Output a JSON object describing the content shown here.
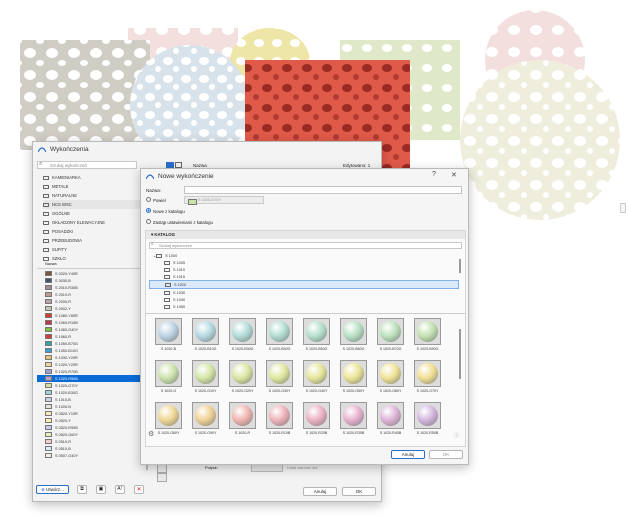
{
  "top_tab_label": "",
  "colors": {
    "accent": "#0a6bd6",
    "selected_row": "#0a6bd6",
    "dialog_bg": "#f3f3f3"
  },
  "main_window": {
    "title": "Wykończenia",
    "search_placeholder": "Szukaj wykończeń",
    "column_name": "Nazwa",
    "column_edited": "Edytowano: 1",
    "folders": [
      "KAMIENIARKA",
      "METALE",
      "NATURALNE",
      "NCS WSC",
      "OGÓLNE",
      "OKŁADZINY ELEWACYJNE",
      "POSADZKI",
      "PRZEBUDOWA",
      "SUFITY",
      "SZKŁO"
    ],
    "list_header": "Nazwa",
    "materials": [
      {
        "name": "S 0020-Y40R",
        "color": "#7a5a3a"
      },
      {
        "name": "S 3030-B",
        "color": "#445566"
      },
      {
        "name": "S 2010-R30B",
        "color": "#a88a96"
      },
      {
        "name": "S 2010-R",
        "color": "#c29898"
      },
      {
        "name": "S 2005-R",
        "color": "#b9a3a3"
      },
      {
        "name": "S 2002-Y",
        "color": "#c9c4b6"
      },
      {
        "name": "S 1080-Y80R",
        "color": "#d23a2a"
      },
      {
        "name": "S 1060-R10B",
        "color": "#c2364d"
      },
      {
        "name": "S 1060-G40Y",
        "color": "#7fbf3a"
      },
      {
        "name": "S 1060-R",
        "color": "#d33a3a"
      },
      {
        "name": "S 1050-B70G",
        "color": "#2fa5a3"
      },
      {
        "name": "S 1050-B10G",
        "color": "#3a9fd1"
      },
      {
        "name": "S 1030-Y20R",
        "color": "#e8c27a"
      },
      {
        "name": "S 1020-Y20R",
        "color": "#efd19a"
      },
      {
        "name": "S 1020-R70B",
        "color": "#9c9fd6"
      },
      {
        "name": "S 1020-R50B",
        "color": "#b89fd0"
      },
      {
        "name": "S 1020-G70Y",
        "color": "#cfe0a4"
      },
      {
        "name": "S 1020-B30G",
        "color": "#9fd0d8"
      },
      {
        "name": "S 1010-B",
        "color": "#c4d6e6"
      },
      {
        "name": "S 1000-N",
        "color": "#e3e3e3"
      },
      {
        "name": "S 0520-Y10R",
        "color": "#f6e6b8"
      },
      {
        "name": "S 0520-Y",
        "color": "#f6efb0"
      },
      {
        "name": "S 0520-R90B",
        "color": "#c6cbee"
      },
      {
        "name": "S 0520-G60Y",
        "color": "#e3efb8"
      },
      {
        "name": "S 0515-R",
        "color": "#f1cfd0"
      },
      {
        "name": "S 0510-B",
        "color": "#dbe9f2"
      },
      {
        "name": "S 0507-G40Y",
        "color": "#eef2de"
      }
    ],
    "selected_index": 15,
    "property_label": "Połysk:",
    "property_placeholder": "Ustal wartość dla",
    "new_button": "Utwórz...",
    "cancel_button": "Anuluj",
    "ok_button": "OK"
  },
  "dialog": {
    "title": "Nowe wykończenie",
    "help_glyph": "?",
    "close_glyph": "✕",
    "name_label": "Nazwa:",
    "name_value": "",
    "duplicate_label": "Powiel",
    "duplicate_value": "S 1020-G70Y",
    "option_new_from_catalog": "Nowe z katalogu",
    "option_link_catalog": "Zastąp ustawieniami z katalogu",
    "catalog_header": "KATALOG",
    "catalog_search_placeholder": "Szukaj wykończeń",
    "catalog_tree": [
      "S 1000",
      "S 1005",
      "S 1010",
      "S 1015",
      "S 1020",
      "S 1030",
      "S 1040",
      "S 1050"
    ],
    "catalog_selected": "S 1020",
    "swatches": [
      {
        "name": "S 1020-B",
        "color": "#bcd3e4"
      },
      {
        "name": "S 1020-B10G",
        "color": "#b6d9e2"
      },
      {
        "name": "S 1020-B30G",
        "color": "#b2dcd8"
      },
      {
        "name": "S 1020-B40G",
        "color": "#b2ddd2"
      },
      {
        "name": "S 1020-B50G",
        "color": "#b5e0cc"
      },
      {
        "name": "S 1020-B60G",
        "color": "#b8e1c4"
      },
      {
        "name": "S 1020-B70G",
        "color": "#bde2bd"
      },
      {
        "name": "S 1020-B90G",
        "color": "#c4e2b2"
      },
      {
        "name": "S 1020-G",
        "color": "#cce3ac"
      },
      {
        "name": "S 1020-G10Y",
        "color": "#d3e5a6"
      },
      {
        "name": "S 1020-G20Y",
        "color": "#dae6a2"
      },
      {
        "name": "S 1020-G30Y",
        "color": "#e0e79e"
      },
      {
        "name": "S 1020-G40Y",
        "color": "#e5e69a"
      },
      {
        "name": "S 1020-G50Y",
        "color": "#ebe597"
      },
      {
        "name": "S 1020-G60Y",
        "color": "#efe395"
      },
      {
        "name": "S 1020-G70Y",
        "color": "#f1df94"
      },
      {
        "name": "S 1020-G80Y",
        "color": "#f0d894"
      },
      {
        "name": "S 1020-G90Y",
        "color": "#f0d196"
      },
      {
        "name": "S 1020-R",
        "color": "#f0b4b0"
      },
      {
        "name": "S 1020-R10B",
        "color": "#efb2bb"
      },
      {
        "name": "S 1020-R20B",
        "color": "#ecb2c4"
      },
      {
        "name": "S 1020-R30B",
        "color": "#e6b3cf"
      },
      {
        "name": "S 1020-R40B",
        "color": "#deb5d8"
      },
      {
        "name": "S 1020-R50B",
        "color": "#d4b7df"
      }
    ],
    "cancel_button": "Anuluj",
    "ok_button": "OK"
  }
}
